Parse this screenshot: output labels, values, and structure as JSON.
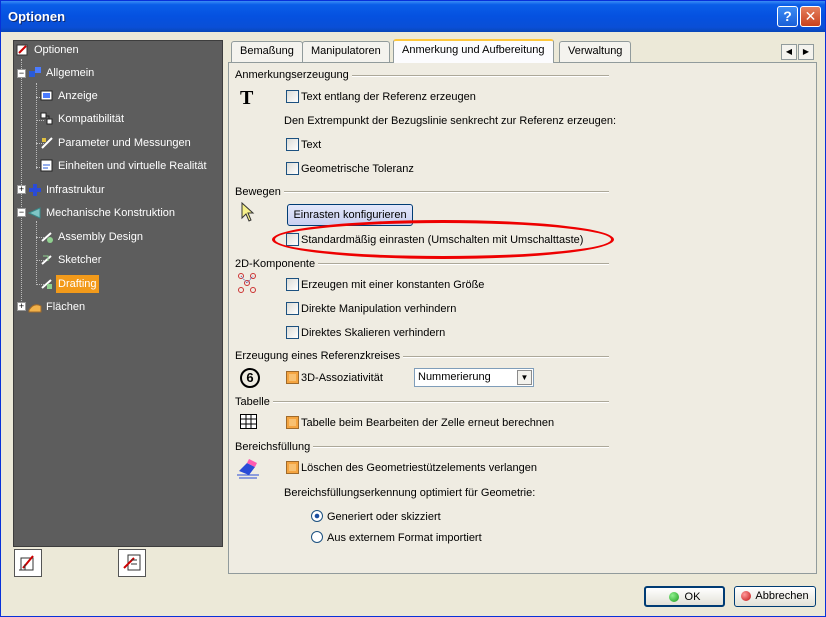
{
  "window": {
    "title": "Optionen",
    "help_label": "?",
    "close_label": "✕"
  },
  "tree": {
    "items": [
      {
        "label": "Optionen"
      },
      {
        "label": "Allgemein"
      },
      {
        "label": "Anzeige"
      },
      {
        "label": "Kompatibilität"
      },
      {
        "label": "Parameter und Messungen"
      },
      {
        "label": "Einheiten und virtuelle Realität"
      },
      {
        "label": "Infrastruktur"
      },
      {
        "label": "Mechanische Konstruktion"
      },
      {
        "label": "Assembly Design"
      },
      {
        "label": "Sketcher"
      },
      {
        "label": "Drafting"
      },
      {
        "label": "Flächen"
      }
    ],
    "selected": "Drafting"
  },
  "tabs": {
    "items": [
      {
        "label": "Bemaßung"
      },
      {
        "label": "Manipulatoren"
      },
      {
        "label": "Anmerkung und Aufbereitung"
      },
      {
        "label": "Verwaltung"
      }
    ],
    "active": "Anmerkung und Aufbereitung",
    "scroll_left": "◀",
    "scroll_right": "▶"
  },
  "sections": {
    "anmerkung": {
      "title": "Anmerkungserzeugung",
      "text_along_ref": "Text entlang der Referenz erzeugen",
      "extrempunkt_info": "Den Extrempunkt der Bezugslinie senkrecht zur Referenz erzeugen:",
      "text": "Text",
      "geom_toleranz": "Geometrische Toleranz"
    },
    "bewegen": {
      "title": "Bewegen",
      "config_button": "Einrasten konfigurieren",
      "snap_default": "Standardmäßig einrasten (Umschalten mit Umschalttaste)"
    },
    "komponente2d": {
      "title": "2D-Komponente",
      "const_size": "Erzeugen mit einer konstanten Größe",
      "no_direct_manip": "Direkte Manipulation verhindern",
      "no_direct_scale": "Direktes Skalieren verhindern"
    },
    "referenzkreis": {
      "title": "Erzeugung eines Referenzkreises",
      "assoc3d": "3D-Assoziativität",
      "select_value": "Nummerierung",
      "icon_text": "6"
    },
    "tabelle": {
      "title": "Tabelle",
      "recalc": "Tabelle beim Bearbeiten der Zelle erneut berechnen"
    },
    "bereich": {
      "title": "Bereichsfüllung",
      "delete_support": "Löschen des Geometriestützelements verlangen",
      "recognition_info": "Bereichsfüllungserkennung optimiert für Geometrie:",
      "radio_generated": "Generiert oder skizziert",
      "radio_external": "Aus externem Format importiert",
      "radio_selected": "Generiert oder skizziert"
    }
  },
  "footer": {
    "ok_label": "OK",
    "cancel_label": "Abbrechen"
  },
  "colors": {
    "selected_tree_bg": "#f29a1a",
    "annotation_ellipse": "#e00000",
    "titlebar": "#0551e0"
  }
}
